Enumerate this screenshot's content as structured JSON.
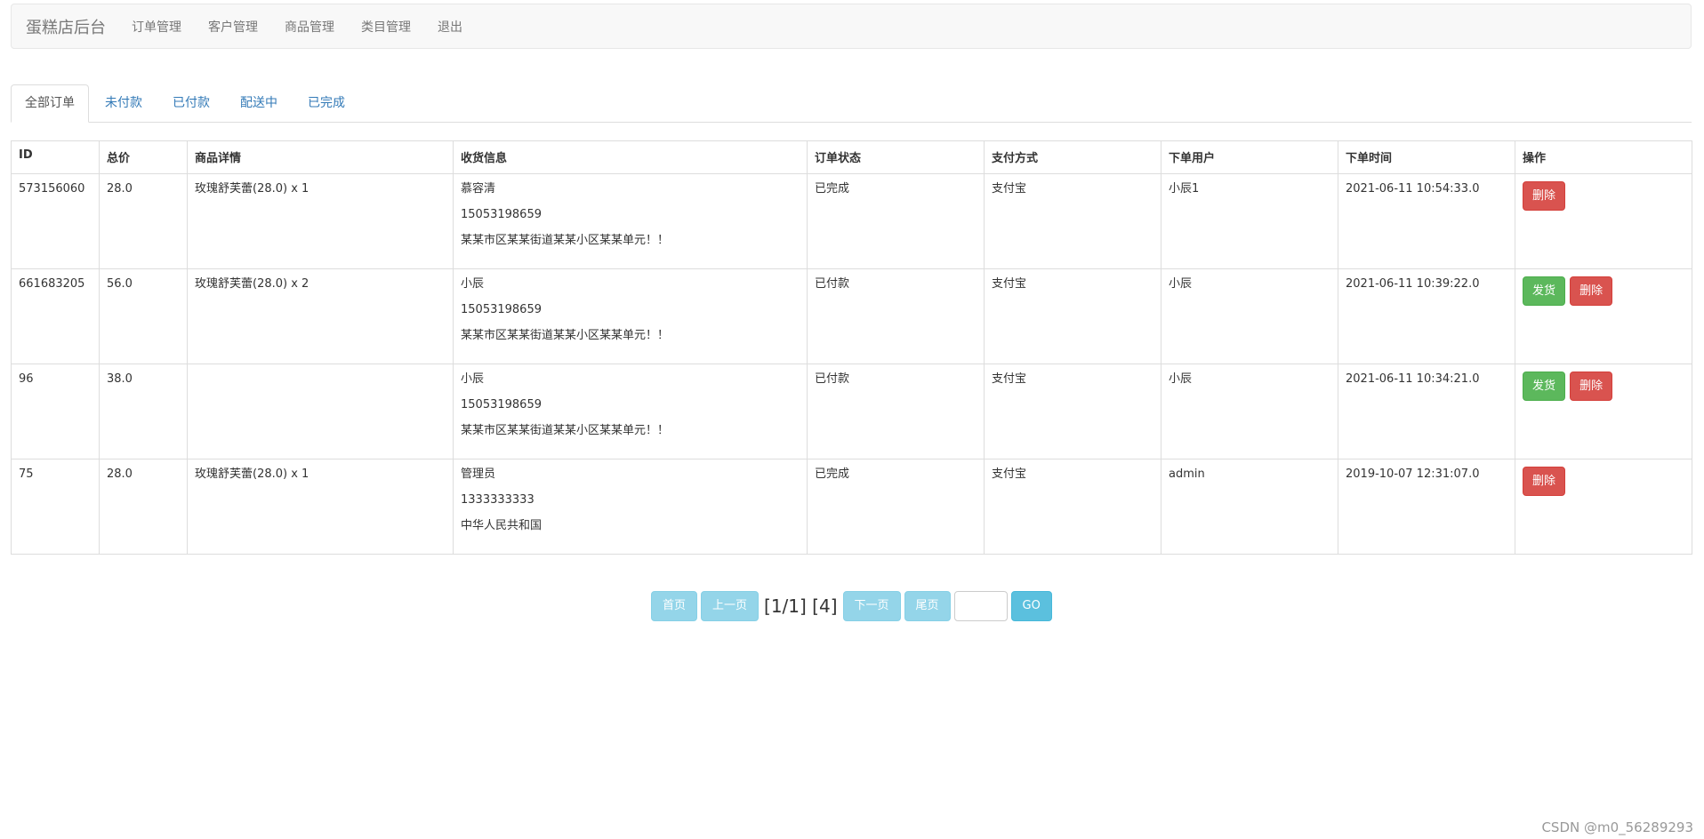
{
  "navbar": {
    "brand": "蛋糕店后台",
    "links": [
      "订单管理",
      "客户管理",
      "商品管理",
      "类目管理",
      "退出"
    ]
  },
  "tabs": [
    "全部订单",
    "未付款",
    "已付款",
    "配送中",
    "已完成"
  ],
  "table": {
    "headers": [
      "ID",
      "总价",
      "商品详情",
      "收货信息",
      "订单状态",
      "支付方式",
      "下单用户",
      "下单时间",
      "操作"
    ],
    "rows": [
      {
        "id": "573156060",
        "total": "28.0",
        "items": "玫瑰舒芙蕾(28.0) x 1",
        "name": "慕容清",
        "phone": "15053198659",
        "address": "某某市区某某街道某某小区某某单元！！",
        "status": "已完成",
        "payment": "支付宝",
        "user": "小辰1",
        "time": "2021-06-11 10:54:33.0",
        "ship_label": "",
        "delete_label": "删除"
      },
      {
        "id": "661683205",
        "total": "56.0",
        "items": "玫瑰舒芙蕾(28.0) x 2",
        "name": "小辰",
        "phone": "15053198659",
        "address": "某某市区某某街道某某小区某某单元！！",
        "status": "已付款",
        "payment": "支付宝",
        "user": "小辰",
        "time": "2021-06-11 10:39:22.0",
        "ship_label": "发货",
        "delete_label": "删除"
      },
      {
        "id": "96",
        "total": "38.0",
        "items": "",
        "name": "小辰",
        "phone": "15053198659",
        "address": "某某市区某某街道某某小区某某单元！！",
        "status": "已付款",
        "payment": "支付宝",
        "user": "小辰",
        "time": "2021-06-11 10:34:21.0",
        "ship_label": "发货",
        "delete_label": "删除"
      },
      {
        "id": "75",
        "total": "28.0",
        "items": "玫瑰舒芙蕾(28.0) x 1",
        "name": "管理员",
        "phone": "1333333333",
        "address": "中华人民共和国",
        "status": "已完成",
        "payment": "支付宝",
        "user": "admin",
        "time": "2019-10-07 12:31:07.0",
        "ship_label": "",
        "delete_label": "删除"
      }
    ]
  },
  "pagination": {
    "first": "首页",
    "prev": "上一页",
    "info": "[1/1] [4]",
    "next": "下一页",
    "last": "尾页",
    "go": "GO",
    "input_value": ""
  },
  "watermark": "CSDN @m0_56289293",
  "colors": {
    "link": "#337ab7",
    "paid_status": "#d9534f",
    "success": "#5cb85c",
    "danger": "#d9534f",
    "info": "#5bc0de"
  }
}
